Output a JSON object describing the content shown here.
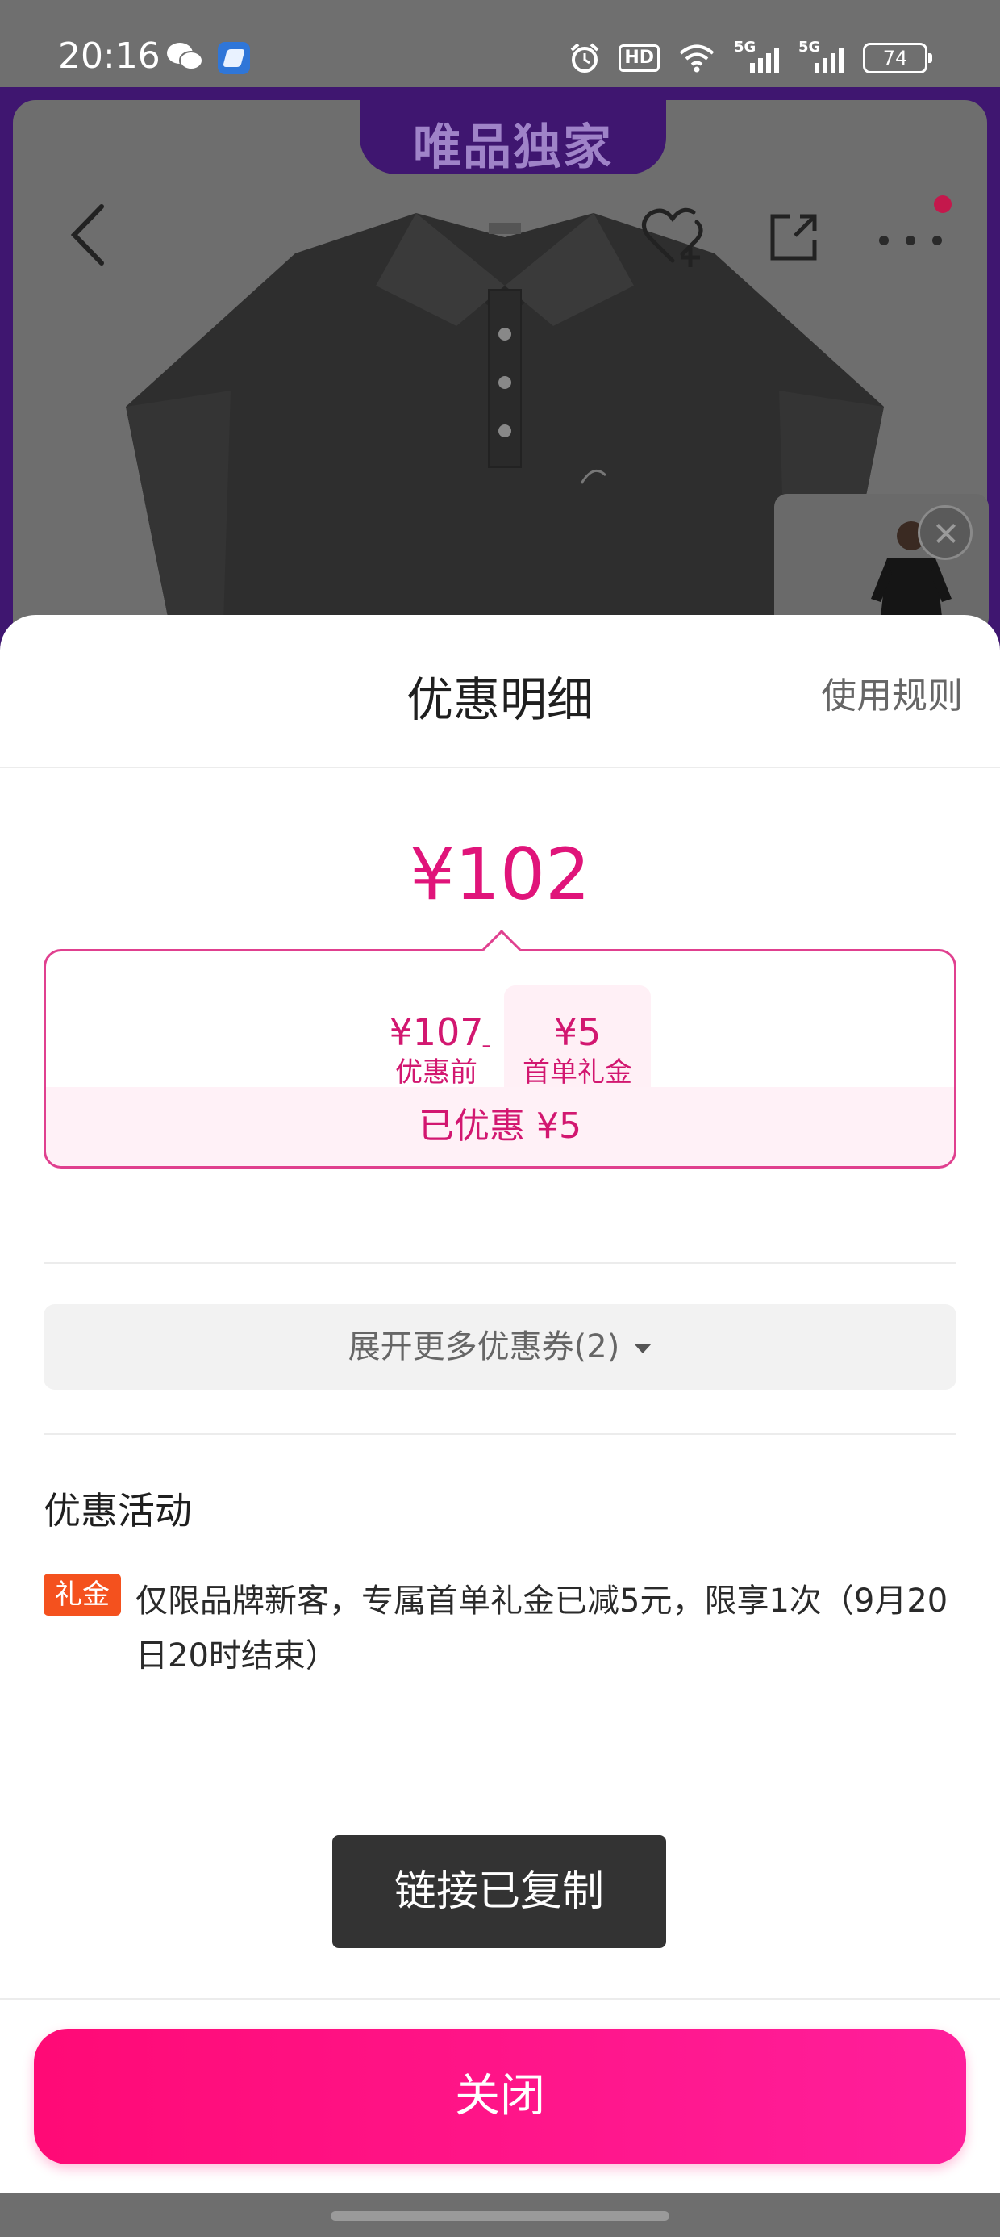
{
  "status_bar": {
    "time": "20:16",
    "hd_badge": "HD",
    "network_1": "5G",
    "network_2": "5G",
    "battery": "74"
  },
  "product": {
    "promo_tab": "唯品独家"
  },
  "sheet": {
    "title": "优惠明细",
    "rules_link": "使用规则",
    "final_price": "¥102",
    "breakdown": {
      "original_price": "¥107",
      "original_label": "优惠前",
      "operator": "-",
      "gift_amount": "¥5",
      "gift_label": "首单礼金",
      "saved_text": "已优惠 ¥5"
    },
    "expand_label": "展开更多优惠券(2)",
    "activities_title": "优惠活动",
    "activity": {
      "tag": "礼金",
      "text": "仅限品牌新客，专属首单礼金已减5元，限享1次（9月20日20时结束）"
    },
    "toast": "链接已复制",
    "close_label": "关闭"
  },
  "colors": {
    "accent": "#e0147a",
    "tag_orange": "#f4511e",
    "promo_purple": "#3f1670"
  }
}
